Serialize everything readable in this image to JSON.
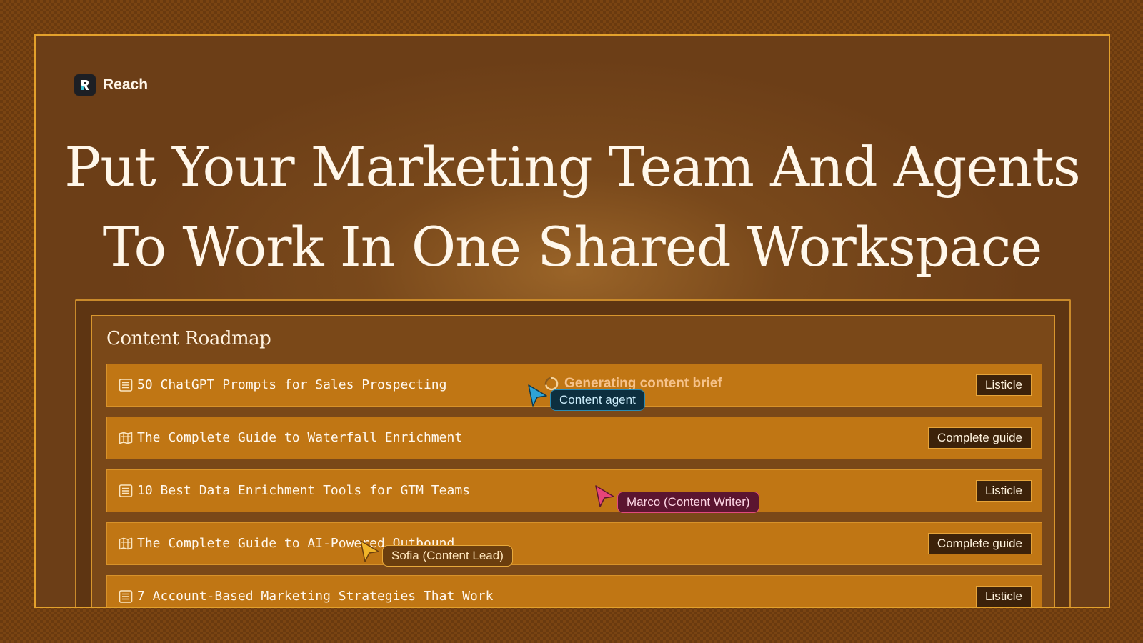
{
  "brand": {
    "name": "Reach"
  },
  "headline": {
    "line1": "Put Your Marketing Team And Agents",
    "line2": "To Work In One Shared Workspace"
  },
  "roadmap": {
    "title": "Content Roadmap",
    "rows": [
      {
        "icon": "list-icon",
        "title": "50 ChatGPT Prompts for Sales Prospecting",
        "tag": "Listicle",
        "status": "Generating content brief"
      },
      {
        "icon": "guide-icon",
        "title": "The Complete Guide to Waterfall Enrichment",
        "tag": "Complete guide"
      },
      {
        "icon": "list-icon",
        "title": "10 Best Data Enrichment Tools for GTM Teams",
        "tag": "Listicle"
      },
      {
        "icon": "guide-icon",
        "title": "The Complete Guide to AI-Powered Outbound",
        "tag": "Complete guide"
      },
      {
        "icon": "list-icon",
        "title": "7 Account-Based Marketing Strategies That Work",
        "tag": "Listicle"
      }
    ]
  },
  "cursors": {
    "agent": {
      "label": "Content agent",
      "color": "#2ea3d6"
    },
    "marco": {
      "label": "Marco (Content Writer)",
      "color": "#e8457a"
    },
    "sofia": {
      "label": "Sofia (Content Lead)",
      "color": "#f0b429"
    }
  },
  "colors": {
    "accent": "#e3a12c",
    "row_bg": "#c07614",
    "tag_bg": "#3c220a",
    "status_text": "#f6c28a"
  }
}
